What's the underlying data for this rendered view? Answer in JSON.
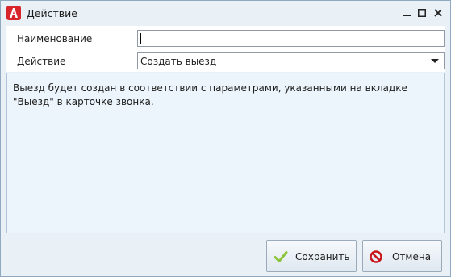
{
  "window": {
    "title": "Действие",
    "controls": {
      "minimize": "minimize-icon",
      "maximize": "maximize-icon",
      "close": "close-icon"
    }
  },
  "form": {
    "name_label": "Наименование",
    "name_value": "",
    "action_label": "Действие",
    "action_value": "Создать выезд"
  },
  "info": {
    "text": "Выезд будет создан в соответствии с параметрами, указанными на вкладке \"Выезд\" в карточке звонка."
  },
  "buttons": {
    "save_label": "Сохранить",
    "cancel_label": "Отмена"
  },
  "colors": {
    "app_logo": "#d8242b",
    "save_check": "#8cc43c",
    "cancel_icon": "#c8161d"
  }
}
